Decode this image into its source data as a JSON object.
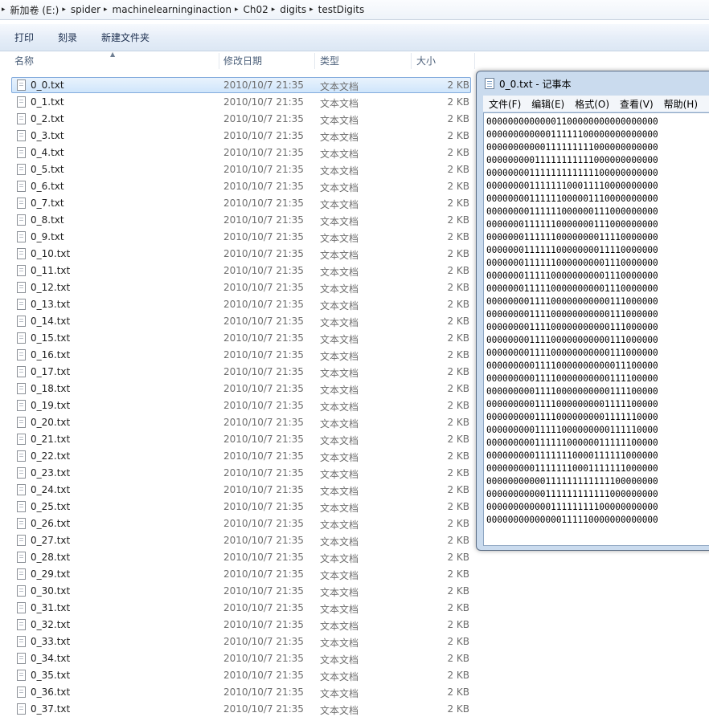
{
  "address": {
    "crumbs": [
      "新加卷 (E:)",
      "spider",
      "machinelearninginaction",
      "Ch02",
      "digits",
      "testDigits"
    ]
  },
  "toolbar": {
    "print_label": "打印",
    "burn_label": "刻录",
    "new_folder_label": "新建文件夹"
  },
  "columns": {
    "name": "名称",
    "date": "修改日期",
    "type": "类型",
    "size": "大小"
  },
  "files": [
    {
      "name": "0_0.txt",
      "date": "2010/10/7 21:35",
      "type": "文本文档",
      "size": "2 KB"
    },
    {
      "name": "0_1.txt",
      "date": "2010/10/7 21:35",
      "type": "文本文档",
      "size": "2 KB"
    },
    {
      "name": "0_2.txt",
      "date": "2010/10/7 21:35",
      "type": "文本文档",
      "size": "2 KB"
    },
    {
      "name": "0_3.txt",
      "date": "2010/10/7 21:35",
      "type": "文本文档",
      "size": "2 KB"
    },
    {
      "name": "0_4.txt",
      "date": "2010/10/7 21:35",
      "type": "文本文档",
      "size": "2 KB"
    },
    {
      "name": "0_5.txt",
      "date": "2010/10/7 21:35",
      "type": "文本文档",
      "size": "2 KB"
    },
    {
      "name": "0_6.txt",
      "date": "2010/10/7 21:35",
      "type": "文本文档",
      "size": "2 KB"
    },
    {
      "name": "0_7.txt",
      "date": "2010/10/7 21:35",
      "type": "文本文档",
      "size": "2 KB"
    },
    {
      "name": "0_8.txt",
      "date": "2010/10/7 21:35",
      "type": "文本文档",
      "size": "2 KB"
    },
    {
      "name": "0_9.txt",
      "date": "2010/10/7 21:35",
      "type": "文本文档",
      "size": "2 KB"
    },
    {
      "name": "0_10.txt",
      "date": "2010/10/7 21:35",
      "type": "文本文档",
      "size": "2 KB"
    },
    {
      "name": "0_11.txt",
      "date": "2010/10/7 21:35",
      "type": "文本文档",
      "size": "2 KB"
    },
    {
      "name": "0_12.txt",
      "date": "2010/10/7 21:35",
      "type": "文本文档",
      "size": "2 KB"
    },
    {
      "name": "0_13.txt",
      "date": "2010/10/7 21:35",
      "type": "文本文档",
      "size": "2 KB"
    },
    {
      "name": "0_14.txt",
      "date": "2010/10/7 21:35",
      "type": "文本文档",
      "size": "2 KB"
    },
    {
      "name": "0_15.txt",
      "date": "2010/10/7 21:35",
      "type": "文本文档",
      "size": "2 KB"
    },
    {
      "name": "0_16.txt",
      "date": "2010/10/7 21:35",
      "type": "文本文档",
      "size": "2 KB"
    },
    {
      "name": "0_17.txt",
      "date": "2010/10/7 21:35",
      "type": "文本文档",
      "size": "2 KB"
    },
    {
      "name": "0_18.txt",
      "date": "2010/10/7 21:35",
      "type": "文本文档",
      "size": "2 KB"
    },
    {
      "name": "0_19.txt",
      "date": "2010/10/7 21:35",
      "type": "文本文档",
      "size": "2 KB"
    },
    {
      "name": "0_20.txt",
      "date": "2010/10/7 21:35",
      "type": "文本文档",
      "size": "2 KB"
    },
    {
      "name": "0_21.txt",
      "date": "2010/10/7 21:35",
      "type": "文本文档",
      "size": "2 KB"
    },
    {
      "name": "0_22.txt",
      "date": "2010/10/7 21:35",
      "type": "文本文档",
      "size": "2 KB"
    },
    {
      "name": "0_23.txt",
      "date": "2010/10/7 21:35",
      "type": "文本文档",
      "size": "2 KB"
    },
    {
      "name": "0_24.txt",
      "date": "2010/10/7 21:35",
      "type": "文本文档",
      "size": "2 KB"
    },
    {
      "name": "0_25.txt",
      "date": "2010/10/7 21:35",
      "type": "文本文档",
      "size": "2 KB"
    },
    {
      "name": "0_26.txt",
      "date": "2010/10/7 21:35",
      "type": "文本文档",
      "size": "2 KB"
    },
    {
      "name": "0_27.txt",
      "date": "2010/10/7 21:35",
      "type": "文本文档",
      "size": "2 KB"
    },
    {
      "name": "0_28.txt",
      "date": "2010/10/7 21:35",
      "type": "文本文档",
      "size": "2 KB"
    },
    {
      "name": "0_29.txt",
      "date": "2010/10/7 21:35",
      "type": "文本文档",
      "size": "2 KB"
    },
    {
      "name": "0_30.txt",
      "date": "2010/10/7 21:35",
      "type": "文本文档",
      "size": "2 KB"
    },
    {
      "name": "0_31.txt",
      "date": "2010/10/7 21:35",
      "type": "文本文档",
      "size": "2 KB"
    },
    {
      "name": "0_32.txt",
      "date": "2010/10/7 21:35",
      "type": "文本文档",
      "size": "2 KB"
    },
    {
      "name": "0_33.txt",
      "date": "2010/10/7 21:35",
      "type": "文本文档",
      "size": "2 KB"
    },
    {
      "name": "0_34.txt",
      "date": "2010/10/7 21:35",
      "type": "文本文档",
      "size": "2 KB"
    },
    {
      "name": "0_35.txt",
      "date": "2010/10/7 21:35",
      "type": "文本文档",
      "size": "2 KB"
    },
    {
      "name": "0_36.txt",
      "date": "2010/10/7 21:35",
      "type": "文本文档",
      "size": "2 KB"
    },
    {
      "name": "0_37.txt",
      "date": "2010/10/7 21:35",
      "type": "文本文档",
      "size": "2 KB"
    }
  ],
  "selected_index": 0,
  "notepad": {
    "title": "0_0.txt - 记事本",
    "menus": [
      "文件(F)",
      "编辑(E)",
      "格式(O)",
      "查看(V)",
      "帮助(H)"
    ],
    "lines": [
      "00000000000001100000000000000000",
      "00000000000011111100000000000000",
      "00000000000111111111000000000000",
      "00000000011111111111000000000000",
      "00000000111111111111100000000000",
      "00000000111111100011110000000000",
      "00000000111111000001110000000000",
      "00000000111111000000111000000000",
      "00000001111110000000111000000000",
      "00000001111110000000011110000000",
      "00000001111110000000011110000000",
      "00000001111110000000001110000000",
      "00000001111100000000001110000000",
      "00000001111100000000001110000000",
      "00000000111100000000000111000000",
      "00000000111100000000000111000000",
      "00000000111100000000000111000000",
      "00000000111100000000000111000000",
      "00000000111100000000000111000000",
      "00000000011110000000000011100000",
      "00000000011110000000000111100000",
      "00000000011110000000000111100000",
      "00000000011110000000001111100000",
      "00000000011110000000001111110000",
      "00000000011111000000000111110000",
      "00000000011111100000011111100000",
      "00000000011111110000111111000000",
      "00000000011111110001111111000000",
      "00000000000111111111111100000000",
      "00000000000111111111111000000000",
      "00000000000011111111100000000000",
      "00000000000000111110000000000000"
    ]
  }
}
